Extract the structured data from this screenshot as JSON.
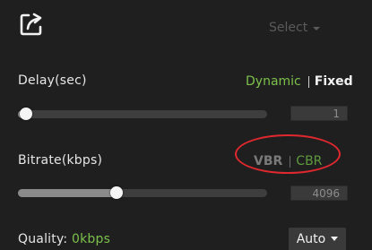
{
  "header": {
    "share_icon": "external-share-icon",
    "select_label": "Select"
  },
  "delay": {
    "label": "Delay(sec)",
    "mode_dynamic": "Dynamic",
    "mode_fixed": "Fixed",
    "active_mode": "Dynamic",
    "slider_fraction": 0.0,
    "value": "1"
  },
  "bitrate": {
    "label": "Bitrate(kbps)",
    "mode_vbr": "VBR",
    "mode_cbr": "CBR",
    "slider_fraction": 0.39,
    "value": "4096"
  },
  "quality": {
    "label": "Quality:",
    "value": "0kbps",
    "dropdown_value": "Auto"
  },
  "colors": {
    "accent_green": "#7cc04b",
    "highlight_red": "#e0282e",
    "background": "#1f1f1f"
  }
}
